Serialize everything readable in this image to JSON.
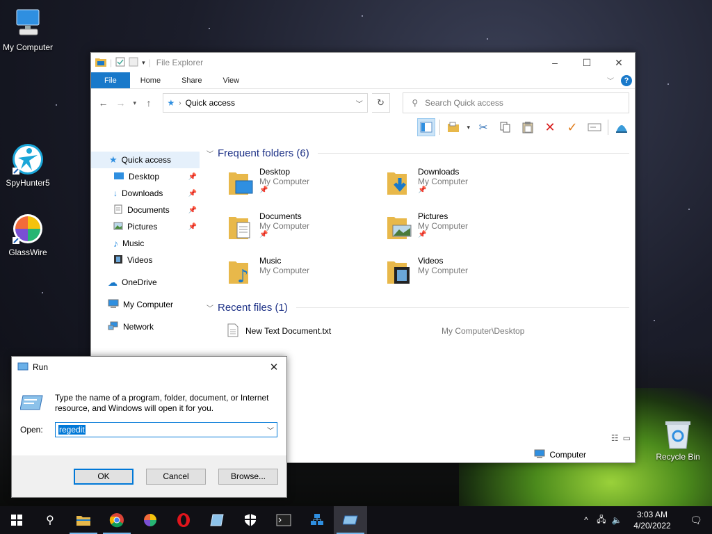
{
  "desktop": {
    "icons": [
      {
        "label": "My Computer"
      },
      {
        "label": "SpyHunter5"
      },
      {
        "label": "GlassWire"
      },
      {
        "label": "Recycle Bin"
      }
    ]
  },
  "explorer": {
    "title": "File Explorer",
    "tabs": {
      "file": "File",
      "home": "Home",
      "share": "Share",
      "view": "View"
    },
    "help": "?",
    "address": "Quick access",
    "search_placeholder": "Search Quick access",
    "nav": {
      "quick_access": "Quick access",
      "desktop": "Desktop",
      "downloads": "Downloads",
      "documents": "Documents",
      "pictures": "Pictures",
      "music": "Music",
      "videos": "Videos",
      "onedrive": "OneDrive",
      "my_computer": "My Computer",
      "network": "Network"
    },
    "frequent_header": "Frequent folders (6)",
    "folders": [
      {
        "name": "Desktop",
        "location": "My Computer"
      },
      {
        "name": "Downloads",
        "location": "My Computer"
      },
      {
        "name": "Documents",
        "location": "My Computer"
      },
      {
        "name": "Pictures",
        "location": "My Computer"
      },
      {
        "name": "Music",
        "location": "My Computer"
      },
      {
        "name": "Videos",
        "location": "My Computer"
      }
    ],
    "recent_header": "Recent files (1)",
    "recent_files": [
      {
        "name": "New Text Document.txt",
        "path": "My Computer\\Desktop"
      }
    ],
    "status": "Computer"
  },
  "run": {
    "title": "Run",
    "message": "Type the name of a program, folder, document, or Internet resource, and Windows will open it for you.",
    "open_label": "Open:",
    "open_value": "regedit",
    "ok": "OK",
    "cancel": "Cancel",
    "browse": "Browse..."
  },
  "taskbar": {
    "time": "3:03 AM",
    "date": "4/20/2022"
  },
  "colors": {
    "accent": "#1979ca",
    "selection": "#0078d7",
    "group_header": "#1e3287",
    "taskbar": "#101015"
  }
}
